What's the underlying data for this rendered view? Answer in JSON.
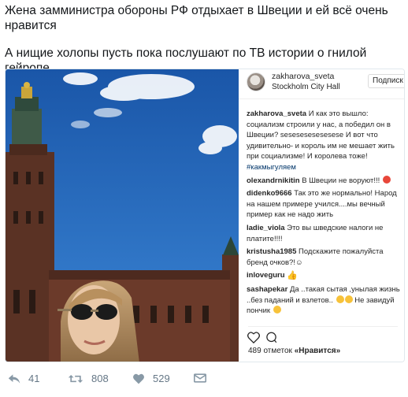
{
  "tweet": {
    "line1": "Жена замминистра обороны РФ отдыхает в Швеции и ей всё очень нравится",
    "line2": "А нищие холопы пусть пока послушают по ТВ истории о гнилой гейропе."
  },
  "instagram": {
    "username": "zakharova_sveta",
    "location": "Stockholm City Hall",
    "follow_label": "Подписк",
    "caption": {
      "user": "zakharova_sveta",
      "text": "И как это вышло: социализм строили у нас, а победил он в Швеции? ѕеѕеѕеѕеѕеѕеѕеѕе И вот что удивительно- и король им не мешает жить при социализме! И королева тоже!",
      "hashtag": "#какмыгуляем"
    },
    "comments": [
      {
        "user": "olexandrnikitin",
        "text": "В Швеции не воруют!!!"
      },
      {
        "user": "didenko9666",
        "text": "Так это же нормально! Народ на нашем примере учился....мы вечный пример как не надо жить"
      },
      {
        "user": "ladie_viola",
        "text": "Это вы шведские налоги не платите!!!!"
      },
      {
        "user": "kristusha1985",
        "text": "Подскажите пожалуйста бренд очков?!☺"
      },
      {
        "user": "inloveguru",
        "text": ""
      },
      {
        "user": "sashapekar",
        "text": "Да ..такая сытая ,унылая жизнь ..без паданий и взлетов..",
        "text_end": "Не завидуй пончик"
      }
    ],
    "likes_count": "489 отметок",
    "likes_word": "«Нравится»"
  },
  "tweet_actions": {
    "replies": "41",
    "retweets": "808",
    "likes": "529"
  },
  "colors": {
    "sky": "#1f5fb4",
    "brick": "#6b3a2a",
    "text": "#14171a",
    "muted": "#657786",
    "ig_link": "#003569"
  }
}
